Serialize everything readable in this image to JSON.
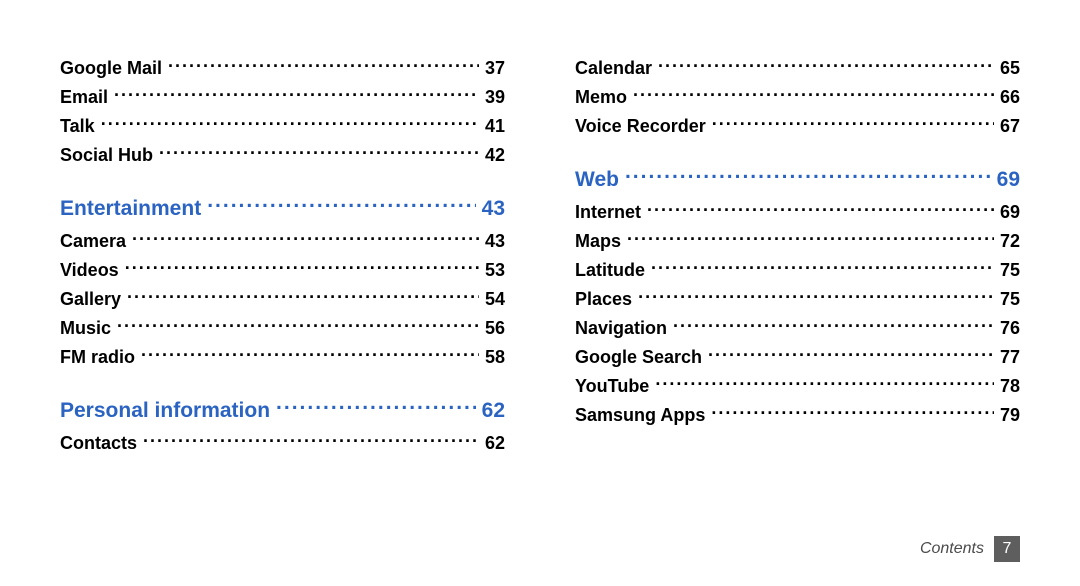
{
  "left": [
    {
      "kind": "item",
      "label": "Google Mail",
      "page": "37"
    },
    {
      "kind": "item",
      "label": "Email",
      "page": "39"
    },
    {
      "kind": "item",
      "label": "Talk",
      "page": "41"
    },
    {
      "kind": "item",
      "label": "Social Hub",
      "page": "42"
    },
    {
      "kind": "section",
      "label": "Entertainment",
      "page": "43"
    },
    {
      "kind": "item",
      "label": "Camera",
      "page": "43"
    },
    {
      "kind": "item",
      "label": "Videos",
      "page": "53"
    },
    {
      "kind": "item",
      "label": "Gallery",
      "page": "54"
    },
    {
      "kind": "item",
      "label": "Music",
      "page": "56"
    },
    {
      "kind": "item",
      "label": "FM radio",
      "page": "58"
    },
    {
      "kind": "section",
      "label": "Personal information",
      "page": "62"
    },
    {
      "kind": "item",
      "label": "Contacts",
      "page": "62"
    }
  ],
  "right": [
    {
      "kind": "item",
      "label": "Calendar",
      "page": "65"
    },
    {
      "kind": "item",
      "label": "Memo",
      "page": "66"
    },
    {
      "kind": "item",
      "label": "Voice Recorder",
      "page": "67"
    },
    {
      "kind": "section",
      "label": "Web",
      "page": "69"
    },
    {
      "kind": "item",
      "label": "Internet",
      "page": "69"
    },
    {
      "kind": "item",
      "label": "Maps",
      "page": "72"
    },
    {
      "kind": "item",
      "label": "Latitude",
      "page": "75"
    },
    {
      "kind": "item",
      "label": "Places",
      "page": "75"
    },
    {
      "kind": "item",
      "label": "Navigation",
      "page": "76"
    },
    {
      "kind": "item",
      "label": "Google Search",
      "page": "77"
    },
    {
      "kind": "item",
      "label": "YouTube",
      "page": "78"
    },
    {
      "kind": "item",
      "label": "Samsung Apps",
      "page": "79"
    }
  ],
  "footer": {
    "section_label": "Contents",
    "page_number": "7"
  }
}
